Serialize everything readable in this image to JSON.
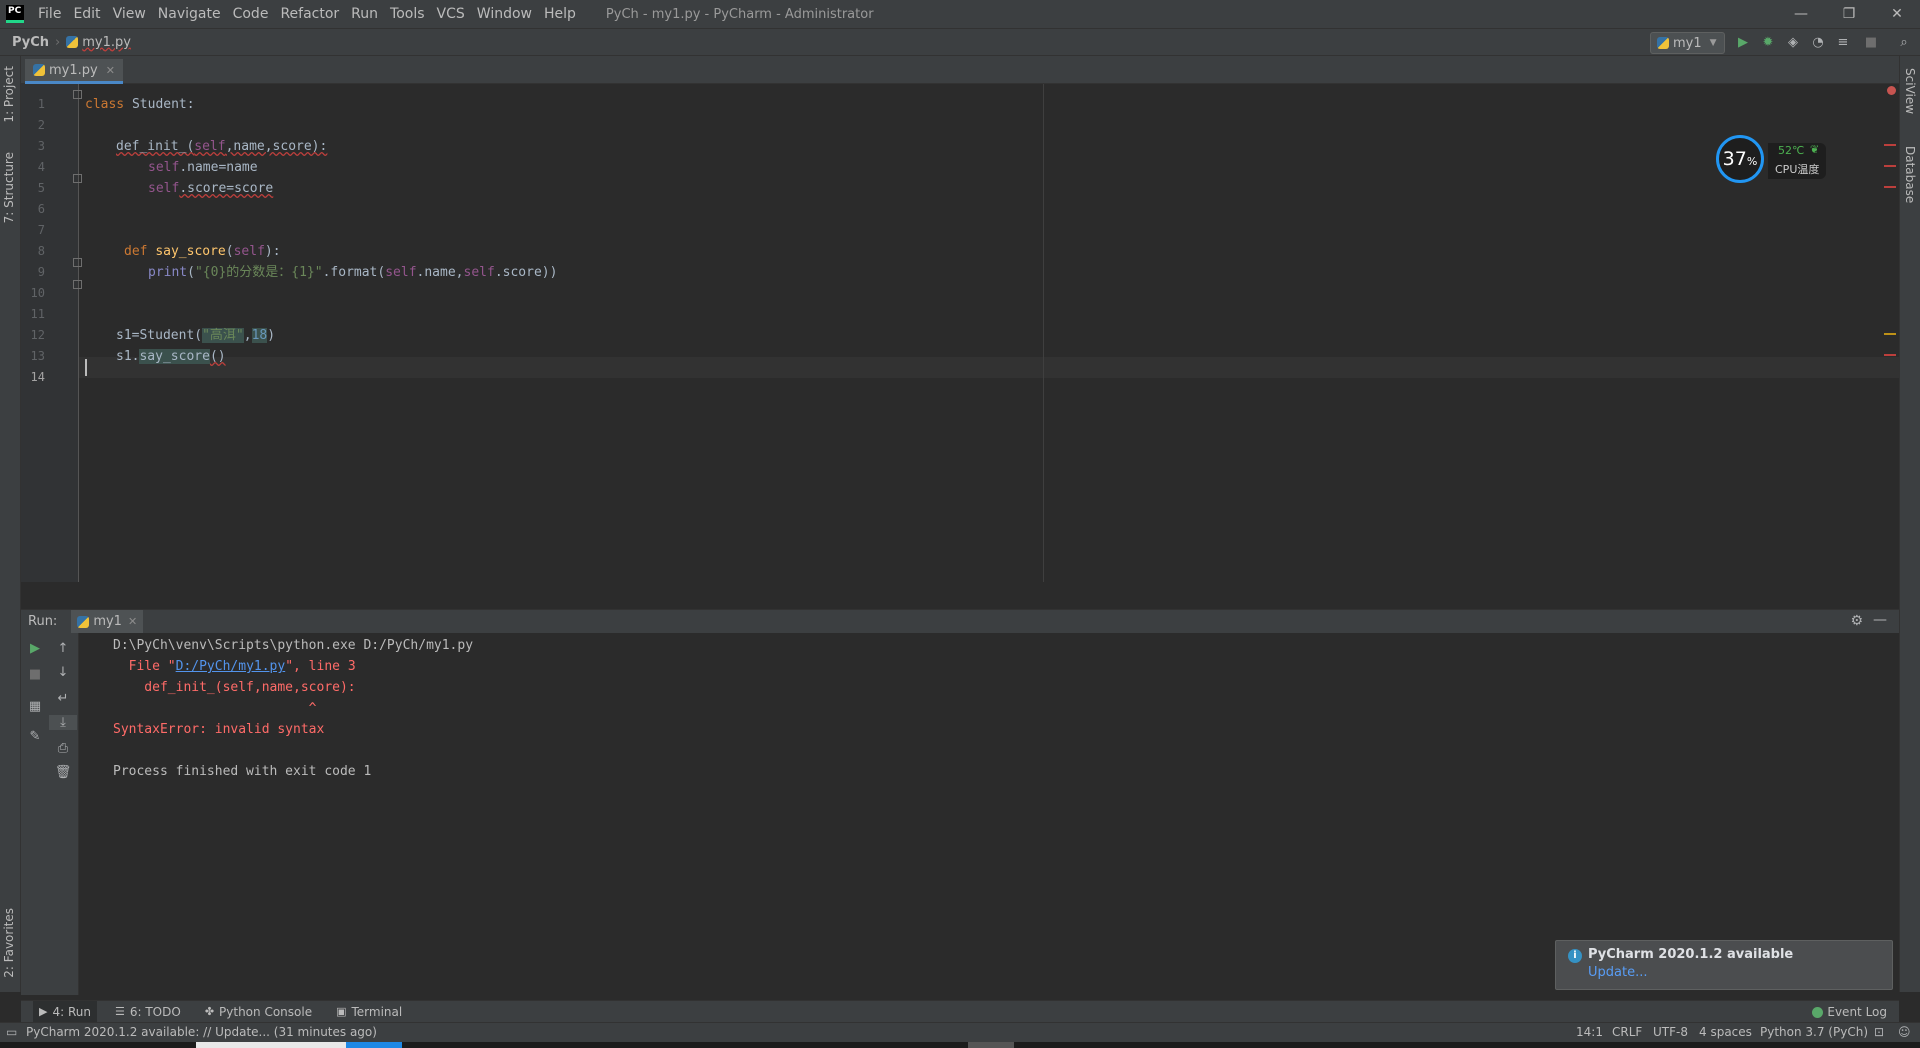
{
  "app": {
    "logo": "PC",
    "window_title": "PyCh - my1.py - PyCharm - Administrator"
  },
  "menu": [
    "File",
    "Edit",
    "View",
    "Navigate",
    "Code",
    "Refactor",
    "Run",
    "Tools",
    "VCS",
    "Window",
    "Help"
  ],
  "navbar": {
    "project": "PyCh",
    "file": "my1.py",
    "run_config": "my1"
  },
  "left_tools": {
    "project": "1: Project",
    "structure": "7: Structure",
    "favorites": "2: Favorites"
  },
  "right_tools": {
    "sciview": "SciView",
    "database": "Database"
  },
  "editor": {
    "tab_label": "my1.py",
    "line_numbers": [
      "1",
      "2",
      "3",
      "4",
      "5",
      "6",
      "7",
      "8",
      "9",
      "10",
      "11",
      "12",
      "13",
      "14"
    ],
    "code": {
      "l1_kw": "class",
      "l1_rest": " Student:",
      "l3_indent": "    ",
      "l3_def": "def_init_(",
      "l3_self": "self",
      "l3_rest": ",name,score):",
      "l4_self": "self",
      "l4_rest": ".name=name",
      "l5_self": "self",
      "l5_rest": ".score=score",
      "l8_kw": "def",
      "l8_fn": "say_score",
      "l8_open": "(",
      "l8_self": "self",
      "l8_close": "):",
      "l9_print": "print",
      "l9_open": "(",
      "l9_str": "\"{0}的分数是：{1}\"",
      "l9_fmt": ".format(",
      "l9_self1": "self",
      "l9_mid": ".name,",
      "l9_self2": "self",
      "l9_end": ".score))",
      "l12_pre": "s1=Student(",
      "l12_str": "\"高洱\"",
      "l12_comma": ",",
      "l12_num": "18",
      "l12_close": ")",
      "l13_pre": "s1.",
      "l13_fn": "say_score",
      "l13_close": "()"
    }
  },
  "cpu_widget": {
    "percent": "37",
    "percent_sign": "%",
    "temperature": "52℃",
    "label": "CPU温度"
  },
  "run_panel": {
    "label": "Run:",
    "tab": "my1",
    "output": {
      "cmd": "D:\\PyCh\\venv\\Scripts\\python.exe D:/PyCh/my1.py",
      "file_pre": "  File \"",
      "file_link": "D:/PyCh/my1.py",
      "file_post": "\", line 3",
      "code_line": "    def_init_(self,name,score):",
      "caret": "                         ^",
      "error": "SyntaxError: invalid syntax",
      "exit": "Process finished with exit code 1"
    }
  },
  "notification": {
    "title": "PyCharm 2020.1.2 available",
    "link": "Update..."
  },
  "bottom_tabs": {
    "run": "4: Run",
    "todo": "6: TODO",
    "console": "Python Console",
    "terminal": "Terminal",
    "event_log": "Event Log"
  },
  "statusbar": {
    "message": "PyCharm 2020.1.2 available: // Update... (31 minutes ago)",
    "position": "14:1",
    "line_sep": "CRLF",
    "encoding": "UTF-8",
    "indent": "4 spaces",
    "interpreter": "Python 3.7 (PyCh)"
  },
  "colors": {
    "background": "#2b2b2b",
    "chrome": "#3c3f41",
    "accent": "#4a88c7",
    "error": "#ff6b68",
    "link": "#5394ec"
  }
}
